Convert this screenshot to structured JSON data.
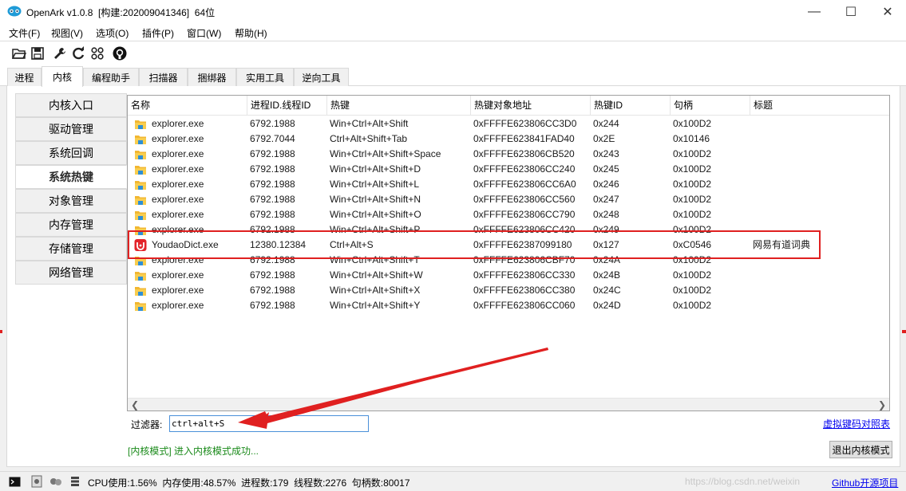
{
  "window": {
    "title": "OpenArk v1.0.8  [构建:202009041346]  64位",
    "minimize": "—",
    "maximize": "☐",
    "close": "✕"
  },
  "menu": [
    {
      "label": "文件(F)"
    },
    {
      "label": "视图(V)"
    },
    {
      "label": "选项(O)"
    },
    {
      "label": "插件(P)"
    },
    {
      "label": "窗口(W)"
    },
    {
      "label": "帮助(H)"
    }
  ],
  "toolbar": {
    "icons": [
      "open-folder-icon",
      "save-icon",
      "wrench-icon",
      "refresh-icon",
      "grid-icon",
      "github-icon"
    ]
  },
  "tabs": [
    {
      "label": "进程"
    },
    {
      "label": "内核",
      "active": true
    },
    {
      "label": "编程助手"
    },
    {
      "label": "扫描器"
    },
    {
      "label": "捆绑器"
    },
    {
      "label": "实用工具"
    },
    {
      "label": "逆向工具"
    }
  ],
  "side_tabs": [
    {
      "label": "内核入口"
    },
    {
      "label": "驱动管理"
    },
    {
      "label": "系统回调"
    },
    {
      "label": "系统热键",
      "active": true
    },
    {
      "label": "对象管理"
    },
    {
      "label": "内存管理"
    },
    {
      "label": "存储管理"
    },
    {
      "label": "网络管理"
    }
  ],
  "table": {
    "columns": [
      "名称",
      "进程ID.线程ID",
      "热键",
      "热键对象地址",
      "热键ID",
      "句柄",
      "标题"
    ],
    "rows": [
      {
        "name": "explorer.exe",
        "pid_tid": "6792.1988",
        "hotkey": "Win+Ctrl+Alt+Shift",
        "address": "0xFFFFE623806CC3D0",
        "id": "0x244",
        "handle": "0x100D2",
        "title": "",
        "icon": "explorer"
      },
      {
        "name": "explorer.exe",
        "pid_tid": "6792.7044",
        "hotkey": "Ctrl+Alt+Shift+Tab",
        "address": "0xFFFFE623841FAD40",
        "id": "0x2E",
        "handle": "0x10146",
        "title": "",
        "icon": "explorer"
      },
      {
        "name": "explorer.exe",
        "pid_tid": "6792.1988",
        "hotkey": "Win+Ctrl+Alt+Shift+Space",
        "address": "0xFFFFE623806CB520",
        "id": "0x243",
        "handle": "0x100D2",
        "title": "",
        "icon": "explorer"
      },
      {
        "name": "explorer.exe",
        "pid_tid": "6792.1988",
        "hotkey": "Win+Ctrl+Alt+Shift+D",
        "address": "0xFFFFE623806CC240",
        "id": "0x245",
        "handle": "0x100D2",
        "title": "",
        "icon": "explorer"
      },
      {
        "name": "explorer.exe",
        "pid_tid": "6792.1988",
        "hotkey": "Win+Ctrl+Alt+Shift+L",
        "address": "0xFFFFE623806CC6A0",
        "id": "0x246",
        "handle": "0x100D2",
        "title": "",
        "icon": "explorer"
      },
      {
        "name": "explorer.exe",
        "pid_tid": "6792.1988",
        "hotkey": "Win+Ctrl+Alt+Shift+N",
        "address": "0xFFFFE623806CC560",
        "id": "0x247",
        "handle": "0x100D2",
        "title": "",
        "icon": "explorer"
      },
      {
        "name": "explorer.exe",
        "pid_tid": "6792.1988",
        "hotkey": "Win+Ctrl+Alt+Shift+O",
        "address": "0xFFFFE623806CC790",
        "id": "0x248",
        "handle": "0x100D2",
        "title": "",
        "icon": "explorer"
      },
      {
        "name": "explorer.exe",
        "pid_tid": "6792.1988",
        "hotkey": "Win+Ctrl+Alt+Shift+P",
        "address": "0xFFFFE623806CC420",
        "id": "0x249",
        "handle": "0x100D2",
        "title": "",
        "icon": "explorer"
      },
      {
        "name": "YoudaoDict.exe",
        "pid_tid": "12380.12384",
        "hotkey": "Ctrl+Alt+S",
        "address": "0xFFFFE62387099180",
        "id": "0x127",
        "handle": "0xC0546",
        "title": "网易有道词典",
        "icon": "youdao"
      },
      {
        "name": "explorer.exe",
        "pid_tid": "6792.1988",
        "hotkey": "Win+Ctrl+Alt+Shift+T",
        "address": "0xFFFFE623806CBF70",
        "id": "0x24A",
        "handle": "0x100D2",
        "title": "",
        "icon": "explorer"
      },
      {
        "name": "explorer.exe",
        "pid_tid": "6792.1988",
        "hotkey": "Win+Ctrl+Alt+Shift+W",
        "address": "0xFFFFE623806CC330",
        "id": "0x24B",
        "handle": "0x100D2",
        "title": "",
        "icon": "explorer"
      },
      {
        "name": "explorer.exe",
        "pid_tid": "6792.1988",
        "hotkey": "Win+Ctrl+Alt+Shift+X",
        "address": "0xFFFFE623806CC380",
        "id": "0x24C",
        "handle": "0x100D2",
        "title": "",
        "icon": "explorer"
      },
      {
        "name": "explorer.exe",
        "pid_tid": "6792.1988",
        "hotkey": "Win+Ctrl+Alt+Shift+Y",
        "address": "0xFFFFE623806CC060",
        "id": "0x24D",
        "handle": "0x100D2",
        "title": "",
        "icon": "explorer"
      }
    ]
  },
  "filter": {
    "label": "过滤器:",
    "value": "ctrl+alt+S"
  },
  "vk_link": "虚拟键码对照表",
  "status_message": "[内核模式] 进入内核模式成功...",
  "exit_kernel_button": "退出内核模式",
  "statusbar": {
    "text": "CPU使用:1.56%  内存使用:48.57%  进程数:179  线程数:2276  句柄数:80017",
    "watermark": "https://blog.csdn.net/weixin",
    "github_link": "Github开源项目"
  },
  "colors": {
    "annotation": "#e02020",
    "link": "#0000ee",
    "status_ok": "#1a8a1a"
  }
}
